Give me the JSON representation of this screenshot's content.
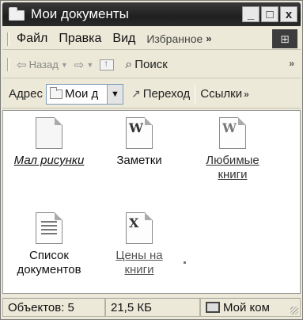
{
  "window": {
    "title": "Мои документы",
    "buttons": {
      "minimize": "_",
      "maximize": "□",
      "close": "x"
    }
  },
  "menu": {
    "items": [
      "Файл",
      "Правка",
      "Вид",
      "Избранное"
    ],
    "more": "»"
  },
  "toolbar": {
    "back_label": "Назад",
    "search_label": "Поиск",
    "more": "»"
  },
  "address": {
    "label": "Адрес",
    "value": "Мои д",
    "go_label": "Переход",
    "links_label": "Ссылки",
    "links_more": "»"
  },
  "files": [
    {
      "label": "Мал рисунки",
      "icon": "picture-file-icon"
    },
    {
      "label": "Заметки",
      "icon": "word-document-icon"
    },
    {
      "label": "Любимые книги",
      "icon": "word-document-icon"
    },
    {
      "label": "Список документов",
      "icon": "text-document-icon"
    },
    {
      "label": "Цены на книги",
      "icon": "excel-document-icon"
    }
  ],
  "status": {
    "count": "Объектов: 5",
    "size": "21,5 КБ",
    "location": "Мой ком"
  }
}
